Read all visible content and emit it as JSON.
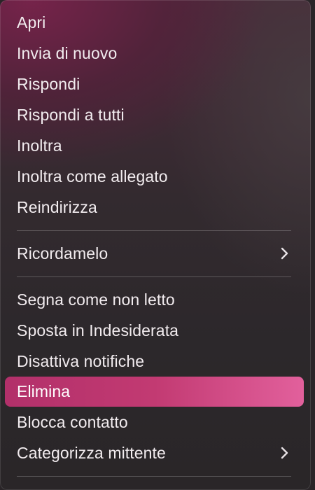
{
  "menu": {
    "items": [
      {
        "label": "Apri"
      },
      {
        "label": "Invia di nuovo"
      },
      {
        "label": "Rispondi"
      },
      {
        "label": "Rispondi a tutti"
      },
      {
        "label": "Inoltra"
      },
      {
        "label": "Inoltra come allegato"
      },
      {
        "label": "Reindirizza"
      },
      {
        "label": "Ricordamelo",
        "submenu": true
      },
      {
        "label": "Segna come non letto"
      },
      {
        "label": "Sposta in Indesiderata"
      },
      {
        "label": "Disattiva notifiche"
      },
      {
        "label": "Elimina",
        "selected": true
      },
      {
        "label": "Blocca contatto"
      },
      {
        "label": "Categorizza mittente",
        "submenu": true
      }
    ],
    "icons": {
      "submenu": "chevron-right-icon"
    },
    "colors": {
      "highlight_start": "#b2306a",
      "highlight_end": "#e2609c",
      "text": "#f2ecef"
    }
  }
}
